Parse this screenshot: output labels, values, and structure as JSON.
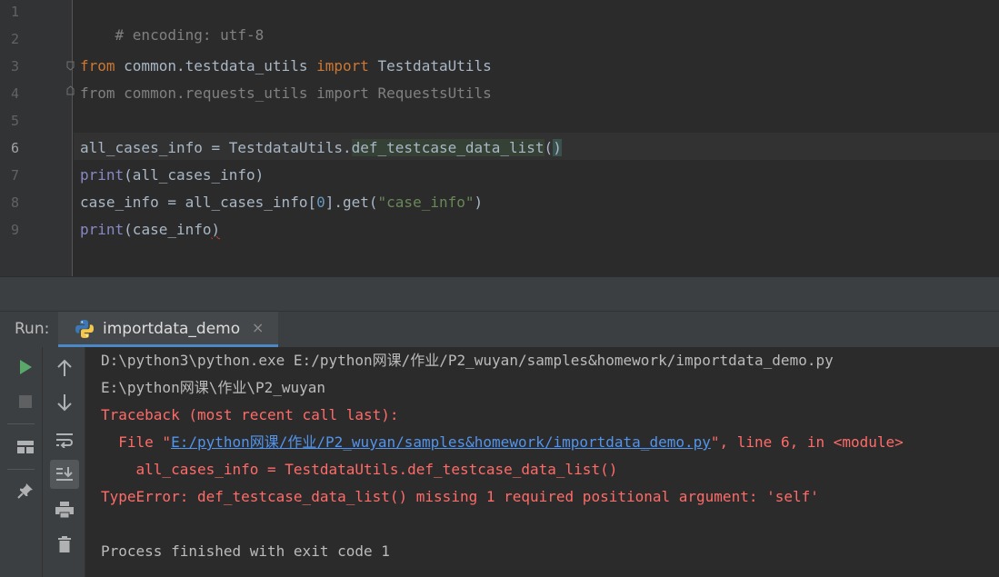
{
  "editor": {
    "line_numbers": [
      "1",
      "2",
      "3",
      "4",
      "5",
      "6",
      "7",
      "8",
      "9"
    ],
    "current_line": "6",
    "code": {
      "l1_comment": "# encoding: utf-8",
      "l3_kw_from": "from",
      "l3_module": " common.testdata_utils ",
      "l3_kw_import": "import",
      "l3_name": " TestdataUtils",
      "l4_text": "from common.requests_utils import RequestsUtils",
      "l6_lhs": "all_cases_info = TestdataUtils.",
      "l6_call": "def_testcase_data_list",
      "l6_paren_open": "(",
      "l6_paren_close": ")",
      "l7_builtin": "print",
      "l7_args": "(all_cases_info)",
      "l8_lhs": "case_info = all_cases_info[",
      "l8_index": "0",
      "l8_mid": "].get(",
      "l8_str": "\"case_info\"",
      "l8_end": ")",
      "l9_builtin": "print",
      "l9_args_a": "(case_info",
      "l9_args_b": ")"
    }
  },
  "run_panel": {
    "label": "Run:",
    "tab_title": "importdata_demo",
    "tab_close": "×",
    "tab_icon": "python-icon",
    "toolbar_left": [
      "run-icon",
      "stop-icon",
      "layout-icon",
      "pin-icon"
    ],
    "toolbar_right": [
      "scroll-up-icon",
      "scroll-down-icon",
      "soft-wrap-icon",
      "scroll-to-end-icon",
      "print-icon",
      "trash-icon"
    ]
  },
  "console": {
    "line1": "D:\\python3\\python.exe E:/python网课/作业/P2_wuyan/samples&homework/importdata_demo.py",
    "line2": "E:\\python网课\\作业\\P2_wuyan",
    "line3": "Traceback (most recent call last):",
    "line4_prefix": "  File \"",
    "line4_link": "E:/python网课/作业/P2_wuyan/samples&homework/importdata_demo.py",
    "line4_suffix": "\", line 6, in <module>",
    "line5": "    all_cases_info = TestdataUtils.def_testcase_data_list()",
    "line6": "TypeError: def_testcase_data_list() missing 1 required positional argument: 'self'",
    "line8": "Process finished with exit code 1"
  },
  "colors": {
    "background": "#2b2b2b",
    "keyword": "#cc7832",
    "error_text": "#ff6b68",
    "link": "#5394ec",
    "run_green": "#59a869"
  }
}
